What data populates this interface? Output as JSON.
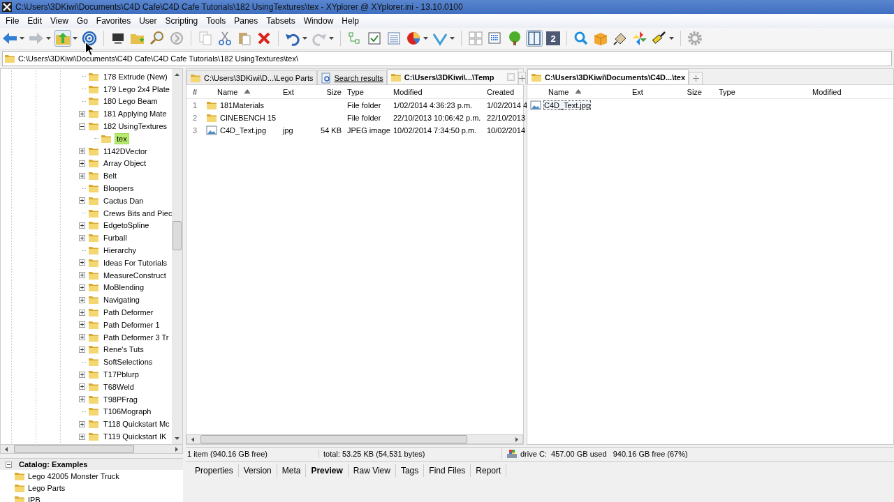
{
  "window": {
    "title": "C:\\Users\\3DKiwi\\Documents\\C4D Cafe\\C4D Cafe Tutorials\\182 UsingTextures\\tex - XYplorer @ XYplorer.ini - 13.10.0100"
  },
  "menu": [
    "File",
    "Edit",
    "View",
    "Go",
    "Favorites",
    "User",
    "Scripting",
    "Tools",
    "Panes",
    "Tabsets",
    "Window",
    "Help"
  ],
  "toolbar": {
    "pane_button_label": "2"
  },
  "address_bar": {
    "value": "C:\\Users\\3DKiwi\\Documents\\C4D Cafe\\C4D Cafe Tutorials\\182 UsingTextures\\tex\\"
  },
  "tree": {
    "items": [
      {
        "label": "178 Extrude (New)",
        "kind": "leaf",
        "selected": false
      },
      {
        "label": "179 Lego 2x4 Plate",
        "kind": "leaf",
        "selected": false
      },
      {
        "label": "180 Lego Beam",
        "kind": "leaf",
        "selected": false
      },
      {
        "label": "181 Applying Mate",
        "kind": "branch",
        "expanded": false,
        "selected": false
      },
      {
        "label": "182 UsingTextures",
        "kind": "branch",
        "expanded": true,
        "selected": false,
        "children": [
          {
            "label": "tex",
            "kind": "leaf",
            "selected": true
          }
        ]
      },
      {
        "label": "1142DVector",
        "kind": "branch",
        "expanded": false,
        "selected": false
      },
      {
        "label": "Array Object",
        "kind": "branch",
        "expanded": false,
        "selected": false
      },
      {
        "label": "Belt",
        "kind": "branch",
        "expanded": false,
        "selected": false
      },
      {
        "label": "Bloopers",
        "kind": "leaf",
        "selected": false
      },
      {
        "label": "Cactus Dan",
        "kind": "branch",
        "expanded": false,
        "selected": false
      },
      {
        "label": "Crews Bits and Piec",
        "kind": "leaf",
        "selected": false
      },
      {
        "label": "EdgetoSpline",
        "kind": "branch",
        "expanded": false,
        "selected": false
      },
      {
        "label": "Furball",
        "kind": "branch",
        "expanded": false,
        "selected": false
      },
      {
        "label": "Hierarchy",
        "kind": "leaf",
        "selected": false
      },
      {
        "label": "Ideas For Tutorials",
        "kind": "branch",
        "expanded": false,
        "selected": false
      },
      {
        "label": "MeasureConstruct",
        "kind": "branch",
        "expanded": false,
        "selected": false
      },
      {
        "label": "MoBlending",
        "kind": "branch",
        "expanded": false,
        "selected": false
      },
      {
        "label": "Navigating",
        "kind": "branch",
        "expanded": false,
        "selected": false
      },
      {
        "label": "Path Deformer",
        "kind": "branch",
        "expanded": false,
        "selected": false
      },
      {
        "label": "Path Deformer 1",
        "kind": "branch",
        "expanded": false,
        "selected": false
      },
      {
        "label": "Path Deformer 3 Tr",
        "kind": "branch",
        "expanded": false,
        "selected": false
      },
      {
        "label": "Rene's Tuts",
        "kind": "branch",
        "expanded": false,
        "selected": false
      },
      {
        "label": "SoftSelections",
        "kind": "leaf",
        "selected": false
      },
      {
        "label": "T17Pblurp",
        "kind": "branch",
        "expanded": false,
        "selected": false
      },
      {
        "label": "T68Weld",
        "kind": "branch",
        "expanded": false,
        "selected": false
      },
      {
        "label": "T98PFrag",
        "kind": "branch",
        "expanded": false,
        "selected": false
      },
      {
        "label": "T106Mograph",
        "kind": "leaf",
        "selected": false
      },
      {
        "label": "T118 Quickstart Mc",
        "kind": "branch",
        "expanded": false,
        "selected": false
      },
      {
        "label": "T119 Quickstart IK",
        "kind": "branch",
        "expanded": false,
        "selected": false
      }
    ]
  },
  "panes": [
    {
      "tabs": [
        {
          "label": "C:\\Users\\3DKiwi\\D...\\Lego Parts",
          "kind": "folder",
          "selected": false
        },
        {
          "label": "Search results",
          "kind": "search",
          "selected": false
        },
        {
          "label": "C:\\Users\\3DKiwi\\...\\Temp",
          "kind": "folder",
          "selected": true
        }
      ],
      "columns": [
        {
          "label": "#",
          "sorted": false
        },
        {
          "label": "Name",
          "sorted": true
        },
        {
          "label": "Ext",
          "sorted": false
        },
        {
          "label": "Size",
          "sorted": false
        },
        {
          "label": "Type",
          "sorted": false
        },
        {
          "label": "Modified",
          "sorted": false
        },
        {
          "label": "Created",
          "sorted": false
        }
      ],
      "rows": [
        {
          "kind": "folder",
          "focused": false,
          "cells": [
            "1",
            "181Materials",
            "",
            "",
            "File folder",
            "1/02/2014 4:36:23 p.m.",
            "1/02/2014 4"
          ]
        },
        {
          "kind": "folder",
          "focused": false,
          "cells": [
            "2",
            "CINEBENCH 15",
            "",
            "",
            "File folder",
            "22/10/2013 10:06:42 p.m.",
            "22/10/2013"
          ]
        },
        {
          "kind": "image",
          "focused": false,
          "cells": [
            "3",
            "C4D_Text.jpg",
            "jpg",
            "54 KB",
            "JPEG image",
            "10/02/2014 7:34:50 p.m.",
            "10/02/2014"
          ]
        }
      ]
    },
    {
      "tabs": [
        {
          "label": "C:\\Users\\3DKiwi\\Documents\\C4D...\\tex",
          "kind": "folder",
          "selected": true
        }
      ],
      "columns": [
        {
          "label": "Name",
          "sorted": true
        },
        {
          "label": "Ext",
          "sorted": false
        },
        {
          "label": "Size",
          "sorted": false
        },
        {
          "label": "Type",
          "sorted": false
        },
        {
          "label": "Modified",
          "sorted": false
        }
      ],
      "rows": [
        {
          "kind": "image",
          "focused": true,
          "cells": [
            "C4D_Text.jpg",
            "",
            "",
            "",
            ""
          ]
        }
      ]
    }
  ],
  "status_bar": {
    "items": "1 item (940.16 GB free)",
    "total": "total: 53.25 KB (54,531 bytes)",
    "drive": "drive C:  457.00 GB used   940.16 GB free (67%)"
  },
  "catalog": {
    "title": "Catalog: Examples",
    "expanded": true,
    "items": [
      "Lego 42005 Monster Truck",
      "Lego Parts",
      "IPB"
    ]
  },
  "info_tabs": [
    {
      "label": "Properties",
      "selected": false
    },
    {
      "label": "Version",
      "selected": false
    },
    {
      "label": "Meta",
      "selected": false
    },
    {
      "label": "Preview",
      "selected": true
    },
    {
      "label": "Raw View",
      "selected": false
    },
    {
      "label": "Tags",
      "selected": false
    },
    {
      "label": "Find Files",
      "selected": false
    },
    {
      "label": "Report",
      "selected": false
    }
  ]
}
